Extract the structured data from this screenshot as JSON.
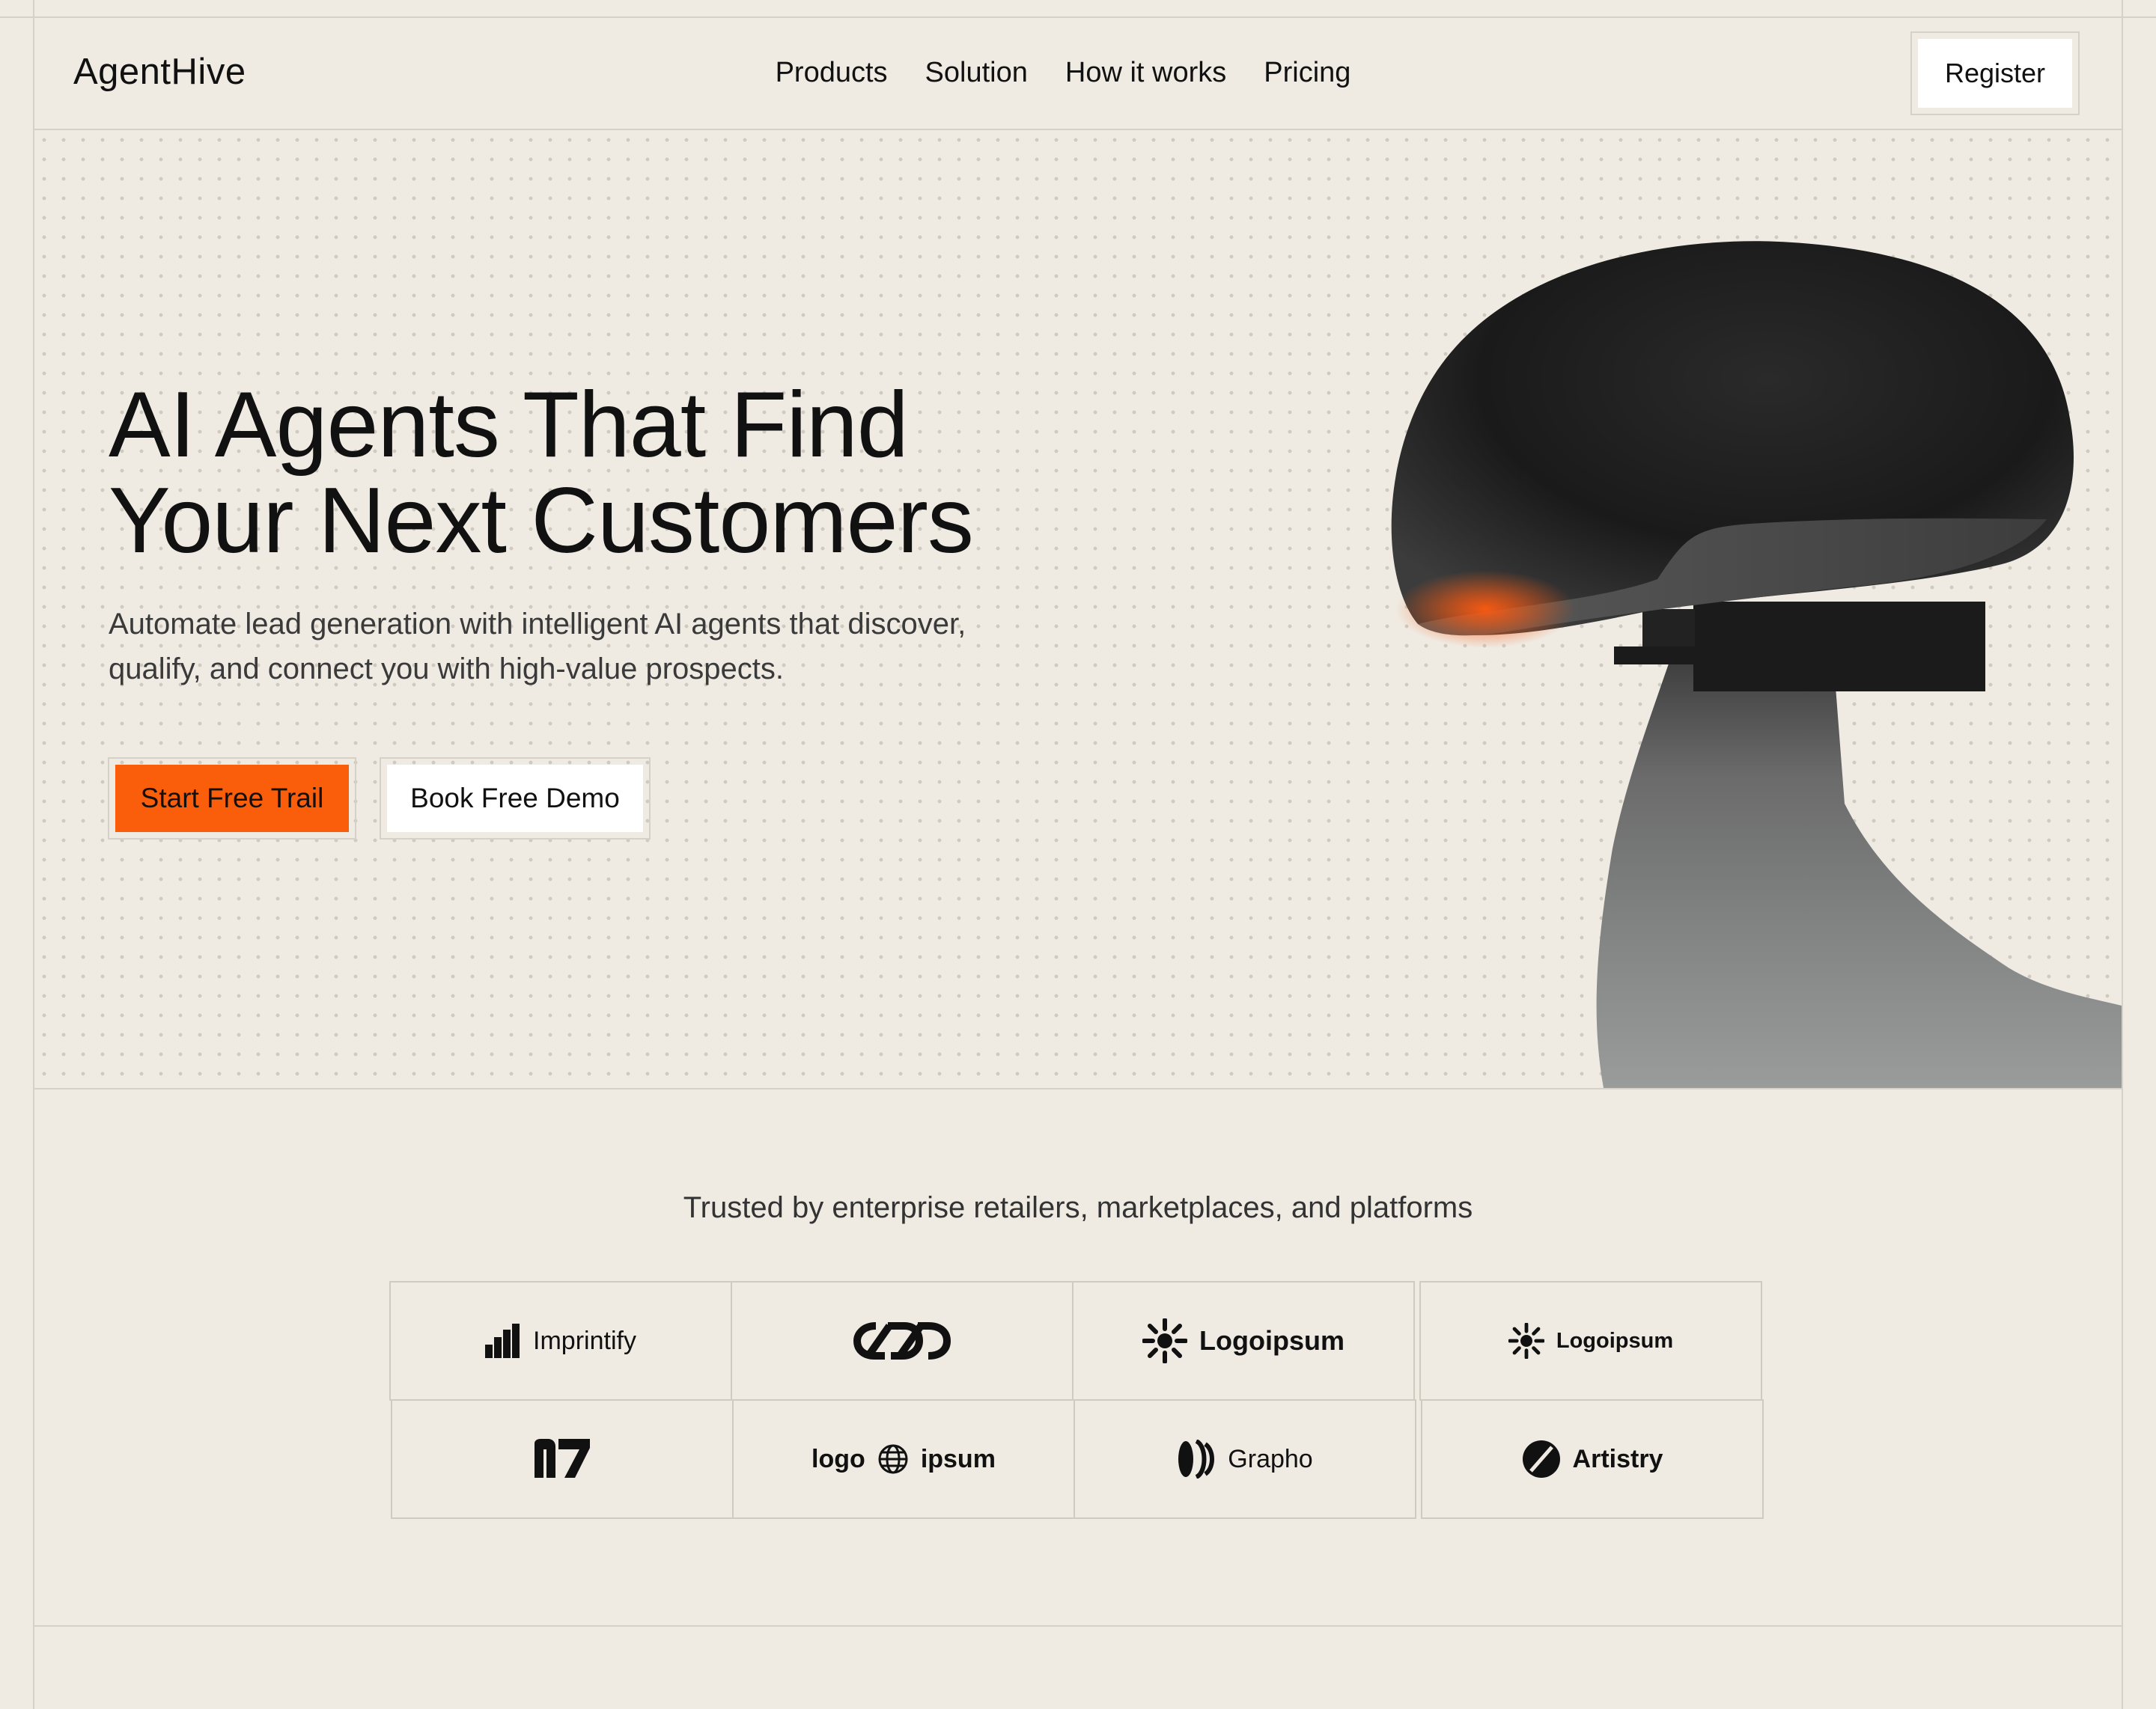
{
  "brand": {
    "name": "AgentHive",
    "accent": "#fa5e0a",
    "background": "#efebe3"
  },
  "nav": {
    "links": [
      "Products",
      "Solution",
      "How it works",
      "Pricing"
    ],
    "register_label": "Register"
  },
  "hero": {
    "headline_line1": "AI Agents That Find",
    "headline_line2": "Your Next Customers",
    "subtext": "Automate lead generation with intelligent AI agents that discover, qualify, and connect you with high-value prospects.",
    "primary_cta": "Start Free Trail",
    "secondary_cta": "Book Free Demo"
  },
  "trusted": {
    "heading": "Trusted by enterprise retailers, marketplaces, and platforms",
    "logos": [
      {
        "name": "Imprintify",
        "icon": "bars-icon"
      },
      {
        "name": "",
        "icon": "chain-links-icon"
      },
      {
        "name": "Logoipsum",
        "icon": "sunburst-icon"
      },
      {
        "name": "Logoipsum",
        "icon": "sunburst-icon"
      },
      {
        "name": "",
        "icon": "n7-monogram-icon"
      },
      {
        "name_left": "logo",
        "name_right": "ipsum",
        "icon": "globe-icon"
      },
      {
        "name": "Grapho",
        "icon": "waves-icon"
      },
      {
        "name": "Artistry",
        "icon": "slashed-circle-icon"
      }
    ]
  }
}
